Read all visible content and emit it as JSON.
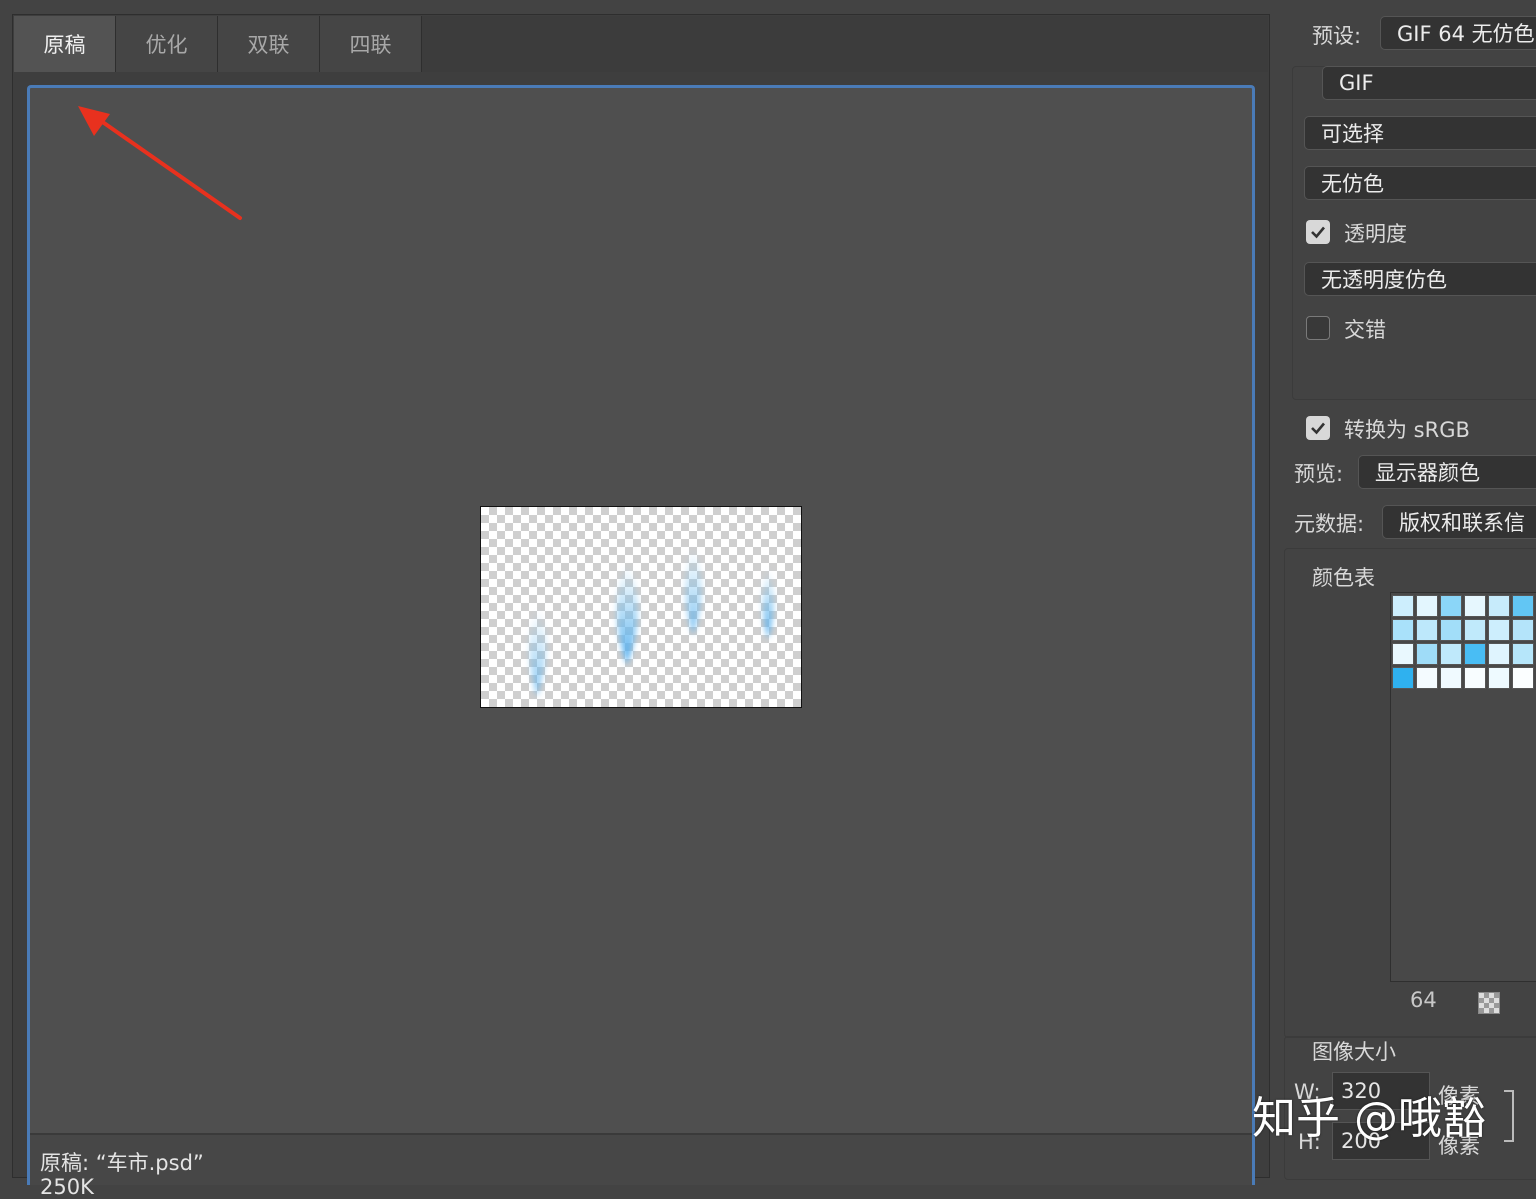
{
  "tabs": [
    "原稿",
    "优化",
    "双联",
    "四联"
  ],
  "active_tab": 0,
  "status": {
    "line1": "原稿: “车市.psd”",
    "line2": "250K"
  },
  "settings": {
    "preset_label": "预设:",
    "preset_value": "GIF 64 无仿色",
    "format": "GIF",
    "reduction": "可选择",
    "dither": "无仿色",
    "transparency_label": "透明度",
    "transparency_checked": true,
    "transparency_dither": "无透明度仿色",
    "interlaced_label": "交错",
    "interlaced_checked": false,
    "srgb_label": "转换为 sRGB",
    "srgb_checked": true,
    "preview_label": "预览:",
    "preview_value": "显示器颜色",
    "metadata_label": "元数据:",
    "metadata_value": "版权和联系信"
  },
  "color_table": {
    "title": "颜色表",
    "count": "64",
    "swatches": [
      "#cdeefd",
      "#e3f6fe",
      "#8bd6f8",
      "#e6f7fe",
      "#c7ebfb",
      "#62c6f4",
      "#a9e1fa",
      "#bde8fb",
      "#a2def9",
      "#c0eafb",
      "#cdeefd",
      "#b4e4fa",
      "#e9f8fe",
      "#9fdcf8",
      "#bfe9fb",
      "#49bdf4",
      "#dff4fe",
      "#b6e6fa",
      "#2fb1ef",
      "#f4fbff",
      "#f0faff",
      "#f8fdff",
      "#eefaff",
      "#fbfeff"
    ]
  },
  "image_size": {
    "title": "图像大小",
    "w_label": "W:",
    "w_value": "320",
    "h_label": "H:",
    "h_value": "200",
    "unit": "像素"
  },
  "watermark": "知乎 @哦豁",
  "colors": {
    "accent": "#4a7bb7",
    "arrow": "#e8311e"
  }
}
